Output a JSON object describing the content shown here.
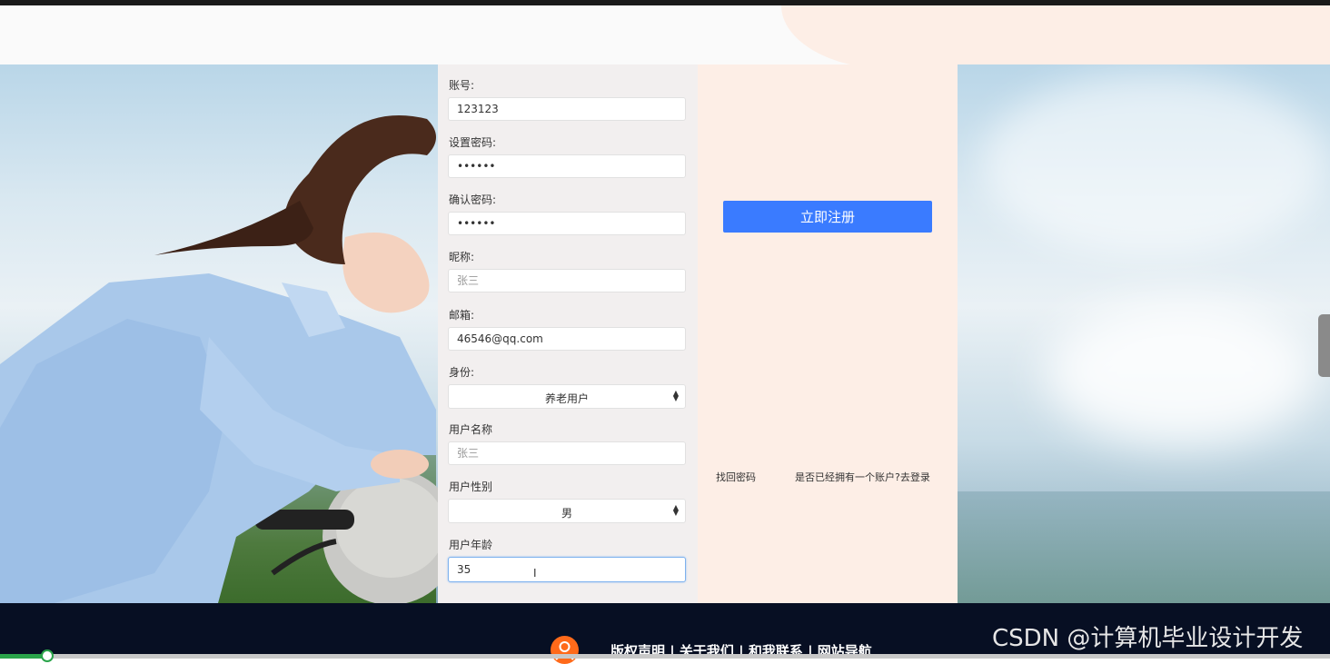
{
  "form": {
    "account_label": "账号:",
    "account_value": "123123",
    "password_label": "设置密码:",
    "password_value": "123123",
    "confirm_label": "确认密码:",
    "confirm_value": "123123",
    "nickname_label": "昵称:",
    "nickname_placeholder": "张三",
    "email_label": "邮箱:",
    "email_value": "46546@qq.com",
    "identity_label": "身份:",
    "identity_selected": "养老用户",
    "username_label": "用户名称",
    "username_placeholder": "张三",
    "gender_label": "用户性别",
    "gender_selected": "男",
    "age_label": "用户年龄",
    "age_value": "35"
  },
  "side": {
    "register_button": "立即注册",
    "find_password": "找回密码",
    "login_link": "是否已经拥有一个账户?去登录"
  },
  "footer": {
    "links": "版权声明 | 关于我们 | 和我联系 | 网站导航"
  },
  "watermark": "CSDN @计算机毕业设计开发",
  "colors": {
    "accent": "#3a7bff",
    "footer_bg": "#070f23",
    "side_panel_bg": "#fdeee6",
    "form_panel_bg": "#f2efef"
  },
  "icons": [
    "user-icon",
    "select-arrows-icon",
    "text-cursor-icon"
  ]
}
